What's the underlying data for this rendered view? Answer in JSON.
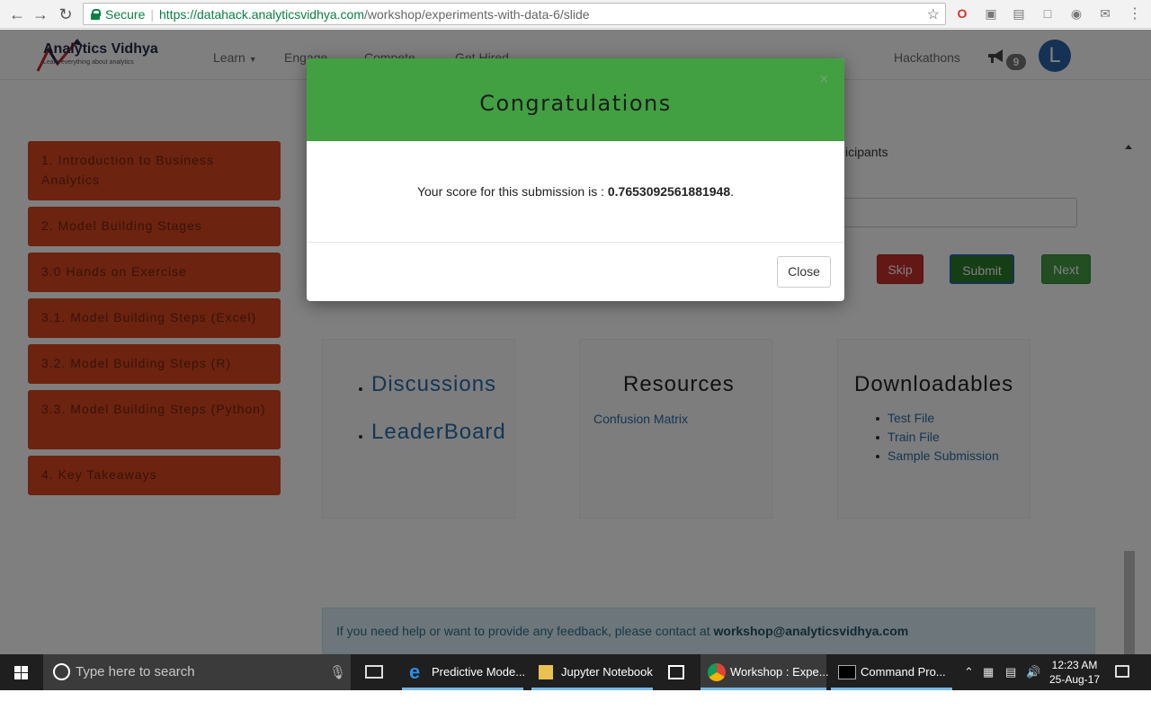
{
  "browser": {
    "secure_label": "Secure",
    "url_host": "https://datahack.analyticsvidhya.com",
    "url_path": "/workshop/experiments-with-data-6/slide"
  },
  "site": {
    "logo_name": "Analytics Vidhya",
    "logo_tagline": "Learn everything about analytics",
    "nav": {
      "learn": "Learn",
      "engage": "Engage",
      "compete": "Compete",
      "get_hired": "Get Hired",
      "hackathons": "Hackathons"
    },
    "notifications_count": "9",
    "avatar_letter": "L",
    "sidebar": [
      {
        "label": "1. Introduction to Business Analytics"
      },
      {
        "label": "2. Model Building Stages"
      },
      {
        "label": "3.0 Hands on Exercise"
      },
      {
        "label": "3.1. Model Building Steps (Excel)"
      },
      {
        "label": "3.2. Model Building Steps (R)"
      },
      {
        "label": "3.3. Model Building Steps (Python)"
      },
      {
        "label": "4. Key Takeaways"
      }
    ],
    "participants_text": "icipants",
    "buttons": {
      "skip": "Skip",
      "submit": "Submit",
      "next": "Next"
    },
    "links_card": {
      "discussions": "Discussions",
      "leaderboard": "LeaderBoard"
    },
    "resources_card": {
      "title": "Resources",
      "items": [
        "Confusion Matrix"
      ]
    },
    "downloads_card": {
      "title": "Downloadables",
      "items": [
        "Test File",
        "Train File",
        "Sample Submission"
      ]
    },
    "help": {
      "text": "If you need help or want to provide any feedback, please contact at",
      "email": "workshop@analyticsvidhya.com"
    }
  },
  "modal": {
    "title": "Congratulations",
    "close_x": "×",
    "score_prefix": "Your score for this submission is :",
    "score_value": "0.7653092561881948",
    "score_suffix": ".",
    "close_button": "Close"
  },
  "taskbar": {
    "search_placeholder": "Type here to search",
    "tasks": [
      {
        "label": "Predictive Mode..."
      },
      {
        "label": "Jupyter Notebook"
      },
      {
        "label": "Workshop : Expe..."
      },
      {
        "label": "Command Pro..."
      }
    ],
    "time": "12:23 AM",
    "date": "25-Aug-17"
  }
}
